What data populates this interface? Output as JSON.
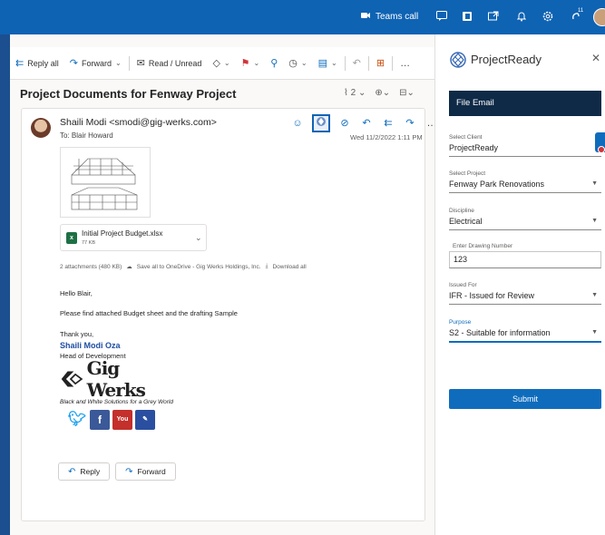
{
  "topbar": {
    "teams_call": "Teams call",
    "icons": [
      "video-icon",
      "chat-icon",
      "office-icon",
      "share-icon",
      "bell-icon",
      "gear-icon",
      "help-icon"
    ],
    "badge_count": "11"
  },
  "toolbar": {
    "reply_all": "Reply all",
    "forward": "Forward",
    "read_unread": "Read / Unread"
  },
  "email": {
    "subject": "Project Documents for Fenway Project",
    "count": "2",
    "sender": "Shaili Modi <smodi@gig-werks.com>",
    "to": "To:  Blair Howard",
    "date": "Wed 11/2/2022 1:11 PM",
    "attachment": {
      "name": "Initial Project Budget.xlsx",
      "size": "77 KB",
      "type_letter": "x"
    },
    "attachments_summary": "2 attachments (480 KB)",
    "save_onedrive": "Save all to OneDrive - Gig Werks Holdings, Inc.",
    "download_all": "Download all",
    "greeting": "Hello Blair,",
    "message": "Please find attached Budget sheet and the drafting Sample",
    "thanks": "Thank you,",
    "sig_name": "Shaili Modi Oza",
    "sig_title": "Head of Development",
    "logo_text": "Gig Werks",
    "tagline": "Black and White Solutions for a Grey World",
    "social": [
      "twitter-icon",
      "facebook-icon",
      "youtube-icon",
      "blog-icon"
    ],
    "reply": "Reply",
    "forward": "Forward"
  },
  "panel": {
    "app_name": "ProjectReady",
    "section": "File Email",
    "fields": [
      {
        "label": "Select Client",
        "value": "ProjectReady"
      },
      {
        "label": "Select Project",
        "value": "Fenway Park Renovations"
      },
      {
        "label": "Discipline",
        "value": "Electrical"
      },
      {
        "label": "Enter Drawing Number",
        "value": "123"
      },
      {
        "label": "Issued For",
        "value": "IFR - Issued for Review"
      },
      {
        "label": "Purpose",
        "value": "S2 - Suitable for information"
      }
    ],
    "submit": "Submit"
  },
  "colors": {
    "brand_blue": "#0f63b3",
    "accent": "#0f6cbd",
    "header_dark": "#0e2a47",
    "excel_green": "#1d7044"
  }
}
